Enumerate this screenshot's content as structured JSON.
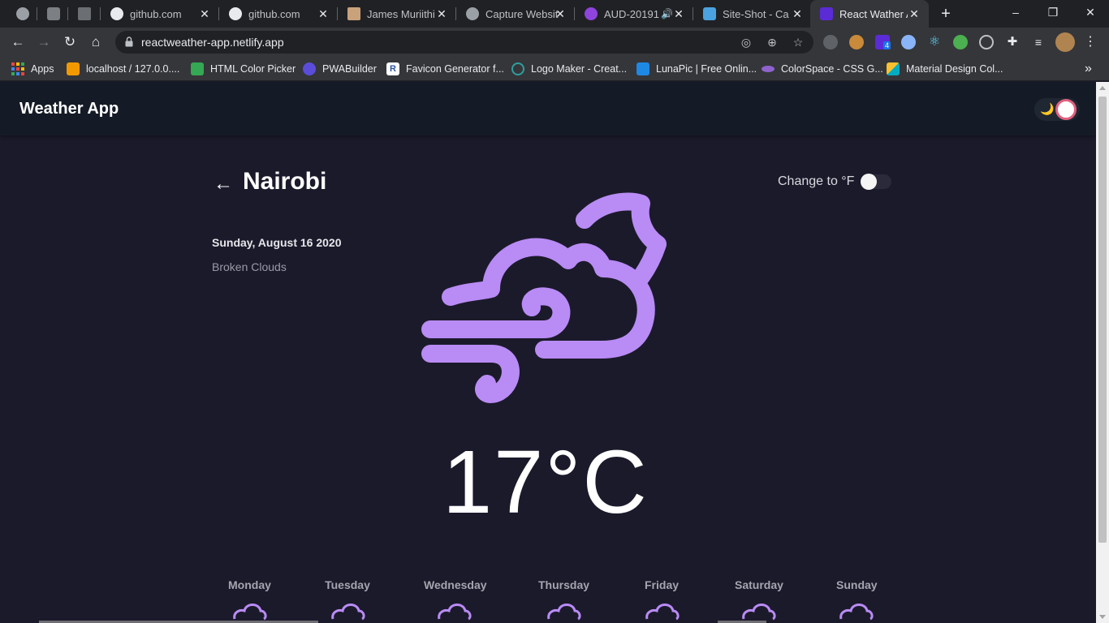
{
  "browser": {
    "tabs": [
      {
        "title": "",
        "icon": "gray-circle-icon"
      },
      {
        "title": "",
        "icon": "gitlab-icon"
      },
      {
        "title": "",
        "icon": "tree-icon"
      },
      {
        "title": "github.com",
        "icon": "github-icon"
      },
      {
        "title": "github.com",
        "icon": "github-icon"
      },
      {
        "title": "James Muriithi",
        "icon": "profile-photo-icon"
      },
      {
        "title": "Capture Websit",
        "icon": "capture-icon"
      },
      {
        "title": "AUD-20191",
        "icon": "audio-icon"
      },
      {
        "title": "Site-Shot - Cap",
        "icon": "camera-icon"
      },
      {
        "title": "React Wather A",
        "icon": "weather-app-icon"
      }
    ],
    "new_tab": "+",
    "window_controls": {
      "minimize": "–",
      "maximize": "❐",
      "close": "✕"
    },
    "url": "reactweather-app.netlify.app",
    "bookmarks": [
      {
        "label": "Apps",
        "color": "#e8453c"
      },
      {
        "label": "localhost / 127.0.0....",
        "color": "#f29900"
      },
      {
        "label": "HTML Color Picker",
        "color": "#34a853"
      },
      {
        "label": "PWABuilder",
        "color": "#5b4dd9"
      },
      {
        "label": "Favicon Generator f...",
        "color": "#ffffff"
      },
      {
        "label": "Logo Maker - Creat...",
        "color": "#2f9e9e"
      },
      {
        "label": "LunaPic | Free Onlin...",
        "color": "#1e88e5"
      },
      {
        "label": "ColorSpace - CSS G...",
        "color": "#8e63ce"
      },
      {
        "label": "Material Design Col...",
        "color": "#fbc02d"
      }
    ],
    "bookmarks_overflow": "»",
    "extension_badge": "4"
  },
  "app": {
    "title": "Weather App",
    "city": "Nairobi",
    "back_arrow": "←",
    "unit_toggle_label": "Change to °F",
    "date": "Sunday, August 16 2020",
    "description": "Broken Clouds",
    "temperature": "17°C",
    "theme_icon": "🌙",
    "accent_color": "#b98bf5",
    "forecast": [
      {
        "day": "Monday"
      },
      {
        "day": "Tuesday"
      },
      {
        "day": "Wednesday"
      },
      {
        "day": "Thursday"
      },
      {
        "day": "Friday"
      },
      {
        "day": "Saturday"
      },
      {
        "day": "Sunday"
      }
    ]
  }
}
